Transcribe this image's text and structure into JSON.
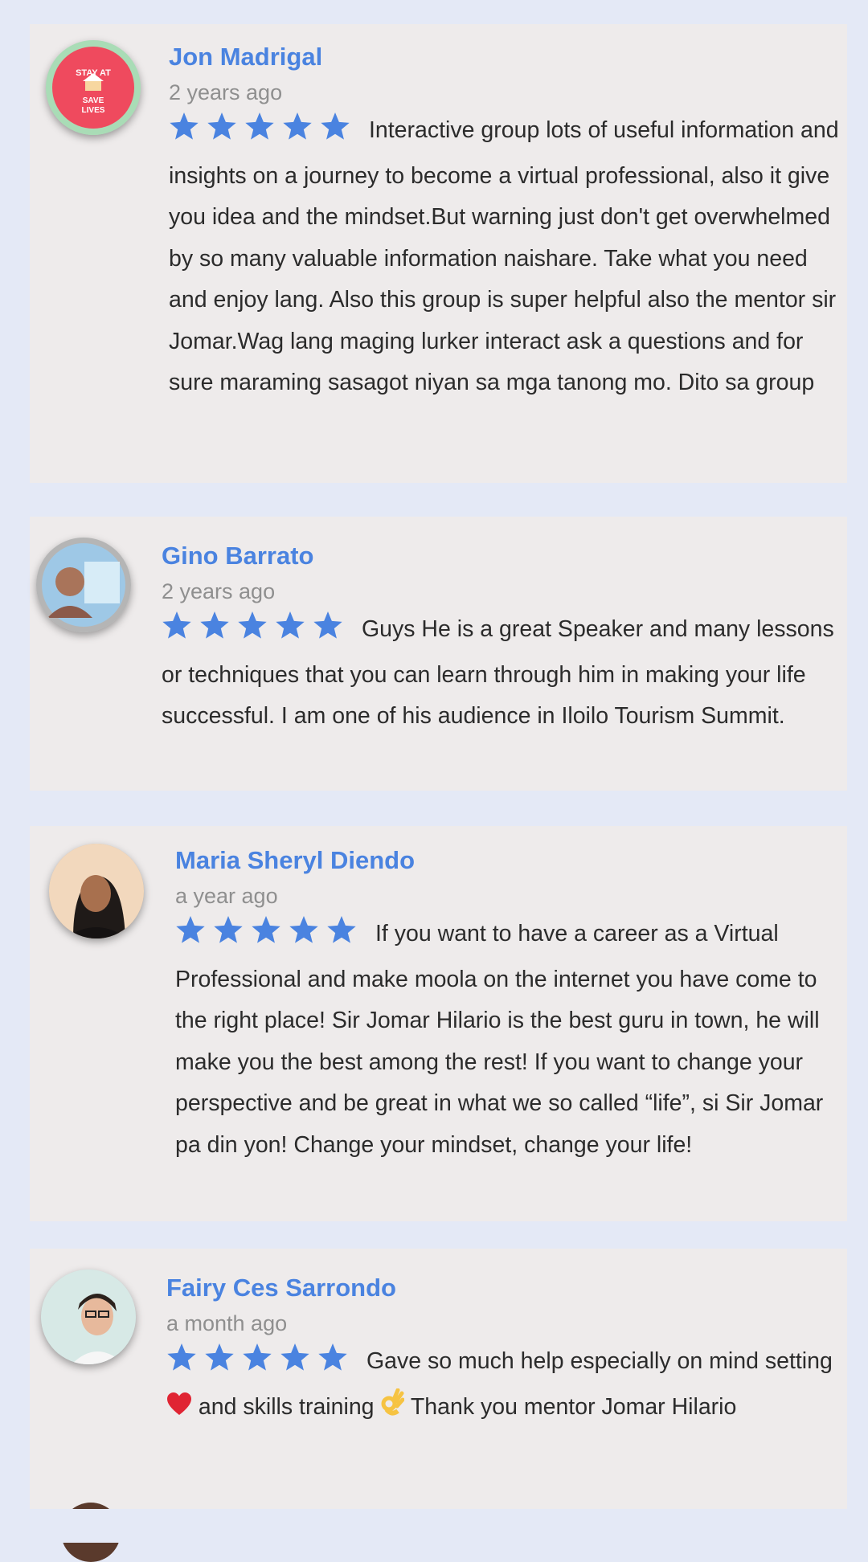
{
  "reviews": [
    {
      "name": "Jon Madrigal",
      "time": "2 years ago",
      "rating": 5,
      "avatar": "stay-at-home-save-lives-badge",
      "text": "Interactive group lots of useful information and insights on a journey to become a virtual professional, also it give you idea and the mindset.But warning just don't get overwhelmed by so many valuable information naishare. Take what you need and enjoy lang. Also this group is super helpful also the mentor sir Jomar.Wag lang maging lurker interact ask a questions and for sure maraming sasagot niyan sa mga tanong mo. Dito sa group"
    },
    {
      "name": "Gino Barrato",
      "time": "2 years ago",
      "rating": 5,
      "avatar": "profile-photo",
      "text": "Guys He is a great Speaker and many lessons or techniques that you can learn through him in making your life successful. I am one of his audience in Iloilo Tourism Summit."
    },
    {
      "name": "Maria Sheryl Diendo",
      "time": "a year ago",
      "rating": 5,
      "avatar": "profile-photo",
      "text": "If you want to have a career as a Virtual Professional and make moola on the internet  you have come to the right place! Sir Jomar Hilario is the best guru in town, he will make you the best among the rest! If you want to change your perspective and be great in what we so called “life”, si Sir Jomar pa din yon! Change your mindset, change your life!"
    },
    {
      "name": "Fairy Ces Sarrondo",
      "time": "a month ago",
      "rating": 5,
      "avatar": "profile-photo",
      "text_parts": [
        "Gave so much help especially on mind setting ",
        " and skills training ",
        " Thank you mentor Jomar Hilario"
      ],
      "emoji_icons": [
        "red-heart-icon",
        "ok-hand-icon"
      ]
    }
  ],
  "colors": {
    "accent": "#4a83e0",
    "card_bg": "#eeebeb",
    "page_bg": "#e4e9f6",
    "time": "#8f8f8f"
  }
}
